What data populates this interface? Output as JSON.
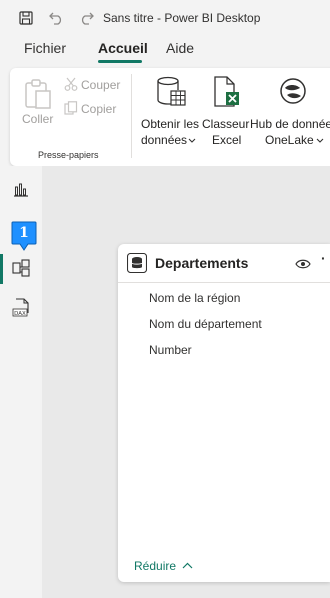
{
  "window": {
    "title": "Sans titre - Power BI Desktop"
  },
  "menu": {
    "items": [
      "Fichier",
      "Accueil",
      "Aide"
    ],
    "active": "Accueil"
  },
  "ribbon": {
    "clipboard": {
      "paste": "Coller",
      "cut": "Couper",
      "copy": "Copier",
      "group_label": "Presse-papiers"
    },
    "get_data": {
      "line1": "Obtenir les",
      "line2": "données"
    },
    "excel": {
      "line1": "Classeur",
      "line2": "Excel"
    },
    "onelake": {
      "line1": "Hub de données",
      "line2": "OneLake"
    }
  },
  "leftrail": {
    "badge_number": "1"
  },
  "table_card": {
    "title": "Departements",
    "fields": [
      "Nom de la région",
      "Nom du département",
      "Number"
    ],
    "collapse_label": "Réduire"
  },
  "colors": {
    "accent": "#117865",
    "excel_green": "#1d6f42",
    "badge_blue": "#1e90ff"
  },
  "icons": [
    "save-icon",
    "undo-icon",
    "redo-icon",
    "paste-icon",
    "cut-icon",
    "copy-icon",
    "database-icon",
    "excel-icon",
    "onelake-icon",
    "report-view-icon",
    "model-view-icon",
    "dax-query-icon",
    "eye-icon",
    "more-icon",
    "chevron-up-icon"
  ]
}
